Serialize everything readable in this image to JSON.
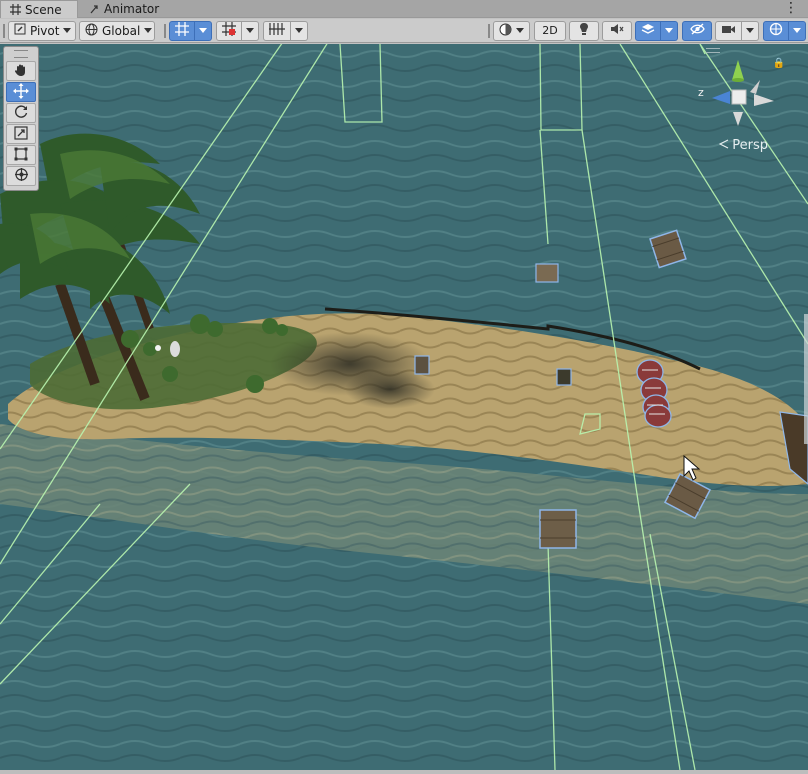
{
  "tabs": [
    {
      "label": "Scene",
      "icon": "grid-icon",
      "active": true
    },
    {
      "label": "Animator",
      "icon": "animator-icon",
      "active": false
    }
  ],
  "toolbar": {
    "pivot_label": "Pivot",
    "global_label": "Global",
    "mode_2d_label": "2D"
  },
  "tools": [
    "hand-tool",
    "move-tool",
    "rotate-tool",
    "scale-tool",
    "rect-tool",
    "transform-tool"
  ],
  "active_tool": "move-tool",
  "gizmo": {
    "axis_label": "z",
    "view_label": "Persp"
  },
  "colors": {
    "accent": "#5a8ed6",
    "water": "#3d6b72",
    "sand": "#b5a06d",
    "collider_line": "#b9f5b0"
  }
}
